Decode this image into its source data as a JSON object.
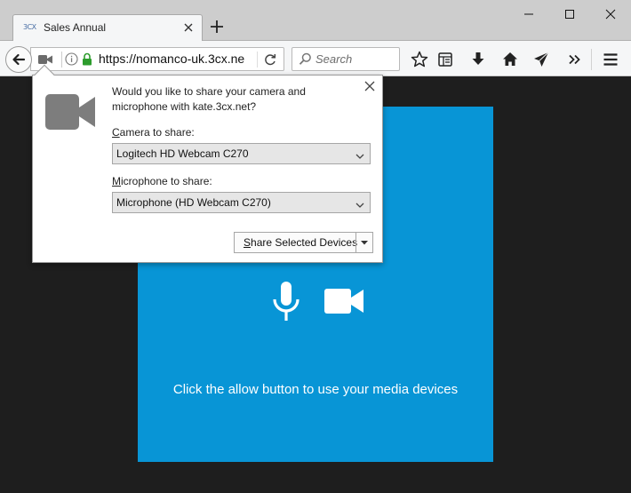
{
  "tab": {
    "favicon_text": "3CX",
    "title": "Sales Annual"
  },
  "navbar": {
    "url": "https://nomanco-uk.3cx.ne",
    "search_placeholder": "Search"
  },
  "popup": {
    "message": "Would you like to share your camera and microphone with kate.3cx.net?",
    "camera_label_accesskey": "C",
    "camera_label_rest": "amera to share:",
    "camera_selected": "Logitech HD Webcam C270",
    "mic_label_accesskey": "M",
    "mic_label_rest": "icrophone to share:",
    "mic_selected": "Microphone (HD Webcam C270)",
    "share_button_accesskey": "S",
    "share_button_rest": "hare Selected Devices"
  },
  "content": {
    "hint": "Click the allow button to use your media devices",
    "panel_color": "#0895d6"
  },
  "icons": [
    "tab-favicon",
    "close-icon",
    "plus-icon",
    "minimize-icon",
    "maximize-icon",
    "window-close-icon",
    "back-arrow-icon",
    "camera-indicator-icon",
    "info-icon",
    "lock-icon",
    "reload-icon",
    "search-icon",
    "star-icon",
    "reader-icon",
    "download-icon",
    "home-icon",
    "send-icon",
    "overflow-icon",
    "hamburger-menu-icon",
    "microphone-icon",
    "video-camera-icon",
    "chevron-down-icon"
  ]
}
